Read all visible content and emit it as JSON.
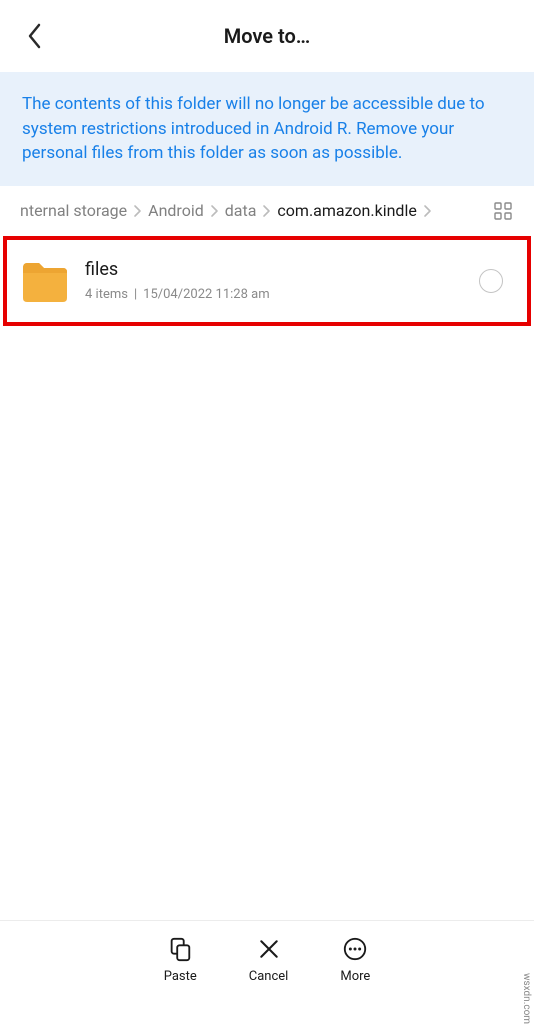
{
  "header": {
    "title": "Move to…"
  },
  "warning": "The contents of this folder will no longer be accessible due to system restrictions introduced in Android R. Remove your personal files from this folder as soon as possible.",
  "breadcrumb": {
    "items": [
      "nternal storage",
      "Android",
      "data",
      "com.amazon.kindle"
    ]
  },
  "folder": {
    "name": "files",
    "count": "4 items",
    "date": "15/04/2022 11:28 am"
  },
  "actions": {
    "paste": "Paste",
    "cancel": "Cancel",
    "more": "More"
  },
  "watermark": "wsxdn.com"
}
